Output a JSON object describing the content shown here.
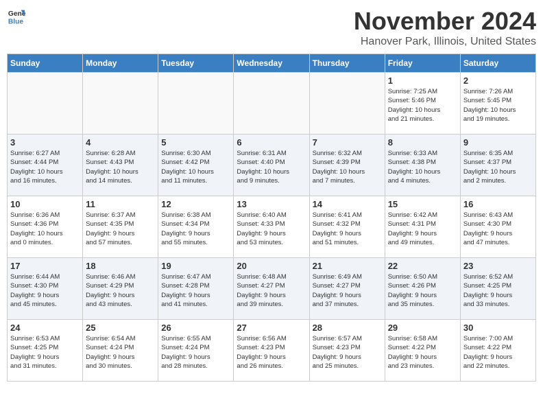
{
  "logo": {
    "text_general": "General",
    "text_blue": "Blue"
  },
  "title": "November 2024",
  "location": "Hanover Park, Illinois, United States",
  "days_of_week": [
    "Sunday",
    "Monday",
    "Tuesday",
    "Wednesday",
    "Thursday",
    "Friday",
    "Saturday"
  ],
  "weeks": [
    [
      {
        "day": "",
        "info": ""
      },
      {
        "day": "",
        "info": ""
      },
      {
        "day": "",
        "info": ""
      },
      {
        "day": "",
        "info": ""
      },
      {
        "day": "",
        "info": ""
      },
      {
        "day": "1",
        "info": "Sunrise: 7:25 AM\nSunset: 5:46 PM\nDaylight: 10 hours\nand 21 minutes."
      },
      {
        "day": "2",
        "info": "Sunrise: 7:26 AM\nSunset: 5:45 PM\nDaylight: 10 hours\nand 19 minutes."
      }
    ],
    [
      {
        "day": "3",
        "info": "Sunrise: 6:27 AM\nSunset: 4:44 PM\nDaylight: 10 hours\nand 16 minutes."
      },
      {
        "day": "4",
        "info": "Sunrise: 6:28 AM\nSunset: 4:43 PM\nDaylight: 10 hours\nand 14 minutes."
      },
      {
        "day": "5",
        "info": "Sunrise: 6:30 AM\nSunset: 4:42 PM\nDaylight: 10 hours\nand 11 minutes."
      },
      {
        "day": "6",
        "info": "Sunrise: 6:31 AM\nSunset: 4:40 PM\nDaylight: 10 hours\nand 9 minutes."
      },
      {
        "day": "7",
        "info": "Sunrise: 6:32 AM\nSunset: 4:39 PM\nDaylight: 10 hours\nand 7 minutes."
      },
      {
        "day": "8",
        "info": "Sunrise: 6:33 AM\nSunset: 4:38 PM\nDaylight: 10 hours\nand 4 minutes."
      },
      {
        "day": "9",
        "info": "Sunrise: 6:35 AM\nSunset: 4:37 PM\nDaylight: 10 hours\nand 2 minutes."
      }
    ],
    [
      {
        "day": "10",
        "info": "Sunrise: 6:36 AM\nSunset: 4:36 PM\nDaylight: 10 hours\nand 0 minutes."
      },
      {
        "day": "11",
        "info": "Sunrise: 6:37 AM\nSunset: 4:35 PM\nDaylight: 9 hours\nand 57 minutes."
      },
      {
        "day": "12",
        "info": "Sunrise: 6:38 AM\nSunset: 4:34 PM\nDaylight: 9 hours\nand 55 minutes."
      },
      {
        "day": "13",
        "info": "Sunrise: 6:40 AM\nSunset: 4:33 PM\nDaylight: 9 hours\nand 53 minutes."
      },
      {
        "day": "14",
        "info": "Sunrise: 6:41 AM\nSunset: 4:32 PM\nDaylight: 9 hours\nand 51 minutes."
      },
      {
        "day": "15",
        "info": "Sunrise: 6:42 AM\nSunset: 4:31 PM\nDaylight: 9 hours\nand 49 minutes."
      },
      {
        "day": "16",
        "info": "Sunrise: 6:43 AM\nSunset: 4:30 PM\nDaylight: 9 hours\nand 47 minutes."
      }
    ],
    [
      {
        "day": "17",
        "info": "Sunrise: 6:44 AM\nSunset: 4:30 PM\nDaylight: 9 hours\nand 45 minutes."
      },
      {
        "day": "18",
        "info": "Sunrise: 6:46 AM\nSunset: 4:29 PM\nDaylight: 9 hours\nand 43 minutes."
      },
      {
        "day": "19",
        "info": "Sunrise: 6:47 AM\nSunset: 4:28 PM\nDaylight: 9 hours\nand 41 minutes."
      },
      {
        "day": "20",
        "info": "Sunrise: 6:48 AM\nSunset: 4:27 PM\nDaylight: 9 hours\nand 39 minutes."
      },
      {
        "day": "21",
        "info": "Sunrise: 6:49 AM\nSunset: 4:27 PM\nDaylight: 9 hours\nand 37 minutes."
      },
      {
        "day": "22",
        "info": "Sunrise: 6:50 AM\nSunset: 4:26 PM\nDaylight: 9 hours\nand 35 minutes."
      },
      {
        "day": "23",
        "info": "Sunrise: 6:52 AM\nSunset: 4:25 PM\nDaylight: 9 hours\nand 33 minutes."
      }
    ],
    [
      {
        "day": "24",
        "info": "Sunrise: 6:53 AM\nSunset: 4:25 PM\nDaylight: 9 hours\nand 31 minutes."
      },
      {
        "day": "25",
        "info": "Sunrise: 6:54 AM\nSunset: 4:24 PM\nDaylight: 9 hours\nand 30 minutes."
      },
      {
        "day": "26",
        "info": "Sunrise: 6:55 AM\nSunset: 4:24 PM\nDaylight: 9 hours\nand 28 minutes."
      },
      {
        "day": "27",
        "info": "Sunrise: 6:56 AM\nSunset: 4:23 PM\nDaylight: 9 hours\nand 26 minutes."
      },
      {
        "day": "28",
        "info": "Sunrise: 6:57 AM\nSunset: 4:23 PM\nDaylight: 9 hours\nand 25 minutes."
      },
      {
        "day": "29",
        "info": "Sunrise: 6:58 AM\nSunset: 4:22 PM\nDaylight: 9 hours\nand 23 minutes."
      },
      {
        "day": "30",
        "info": "Sunrise: 7:00 AM\nSunset: 4:22 PM\nDaylight: 9 hours\nand 22 minutes."
      }
    ]
  ]
}
